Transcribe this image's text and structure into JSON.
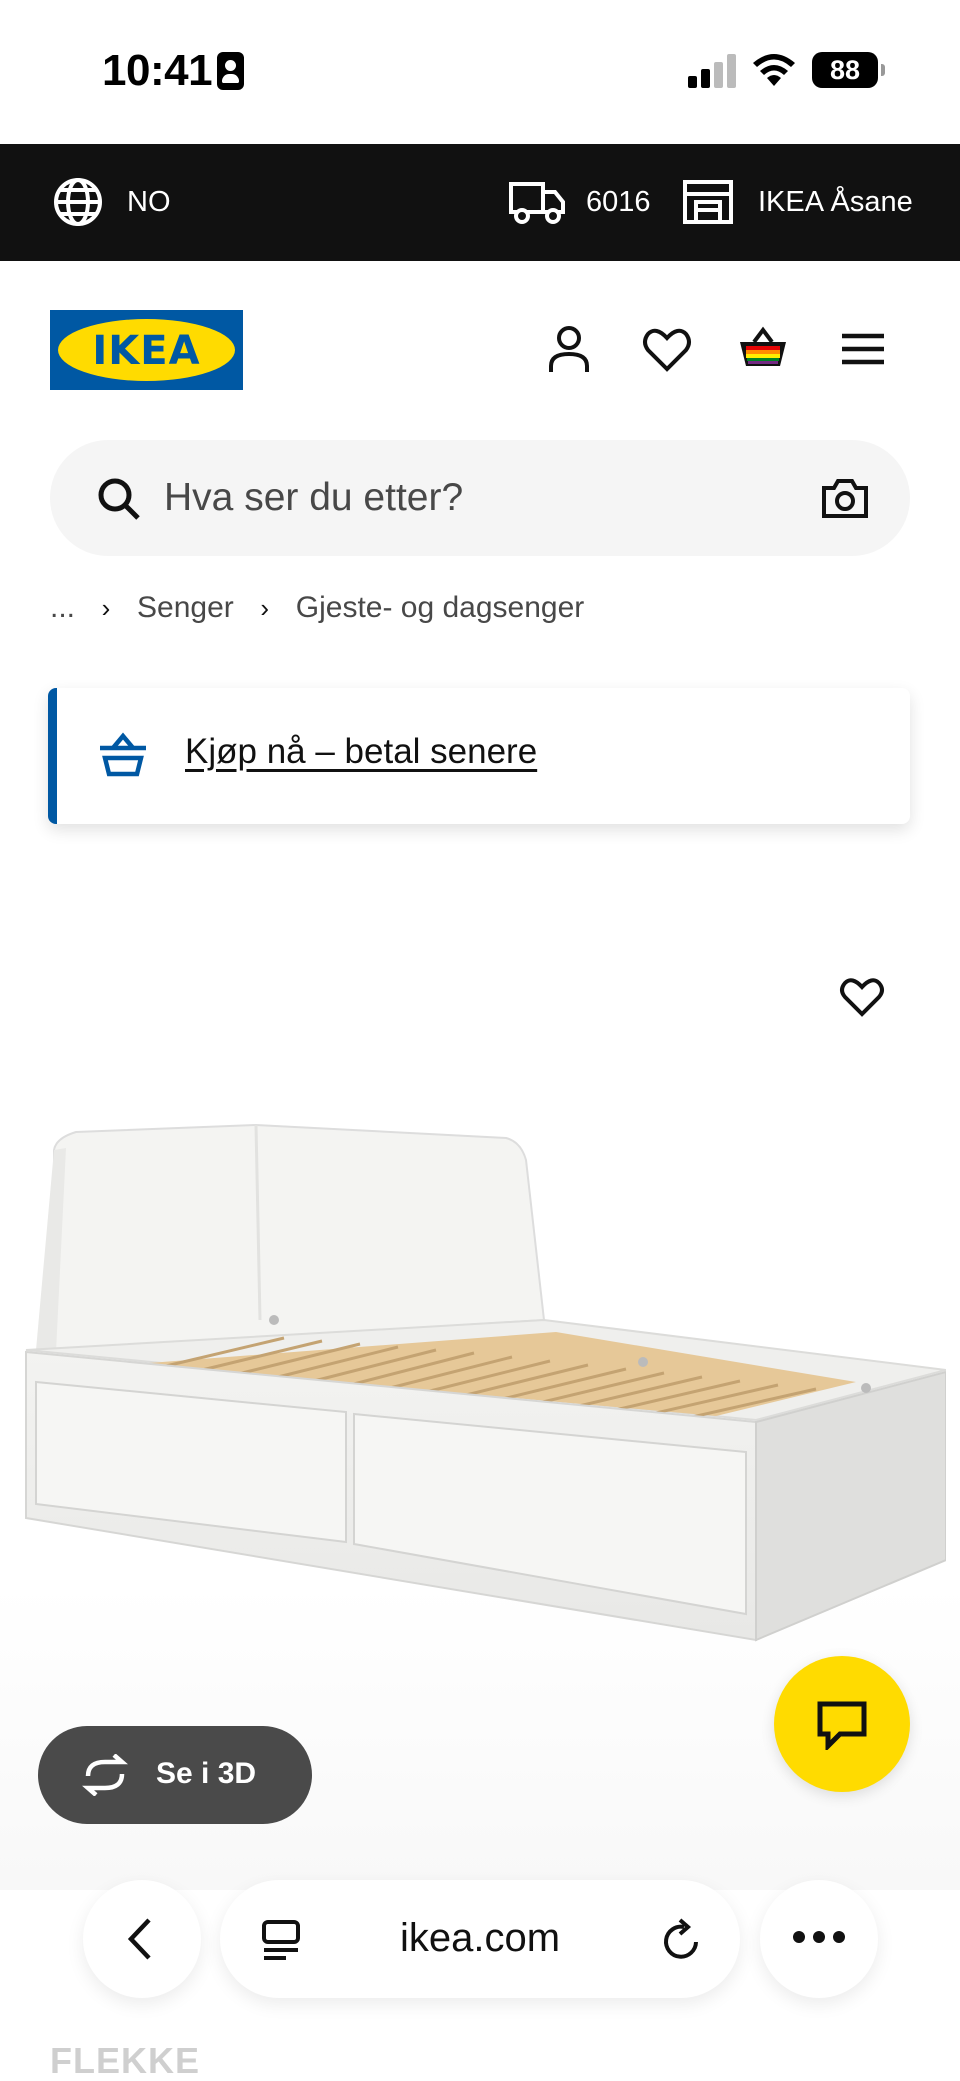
{
  "status_bar": {
    "time": "10:41",
    "battery": "88"
  },
  "top_bar": {
    "language": "NO",
    "postal_code": "6016",
    "store": "IKEA Åsane"
  },
  "header": {
    "logo_text": "IKEA"
  },
  "search": {
    "placeholder": "Hva ser du etter?"
  },
  "breadcrumb": {
    "ellipsis": "...",
    "items": [
      "Senger",
      "Gjeste- og dagsenger"
    ]
  },
  "promo": {
    "link_text": "Kjøp nå – betal senere"
  },
  "product": {
    "view_3d_label": "Se i 3D",
    "name_partial": "FLEKKE"
  },
  "browser": {
    "url": "ikea.com"
  },
  "colors": {
    "brand_blue": "#0058a3",
    "brand_yellow": "#ffdb00",
    "topbar_bg": "#111111"
  }
}
